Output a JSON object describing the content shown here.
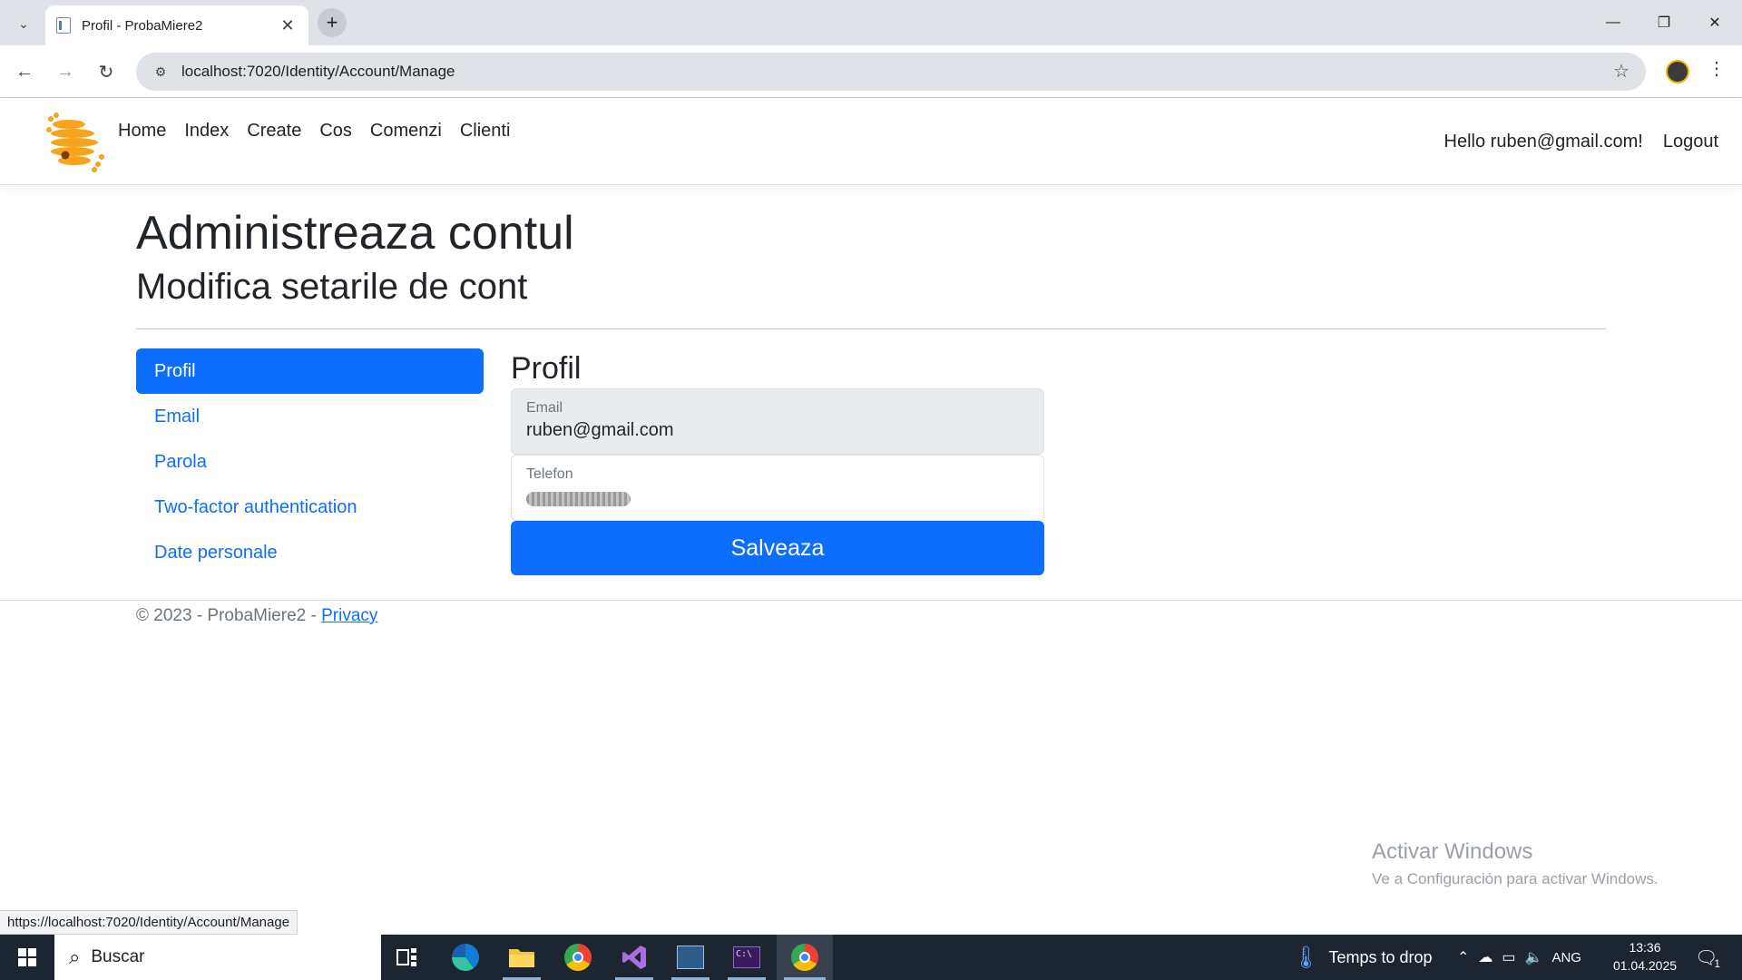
{
  "browser": {
    "tab_title": "Profil - ProbaMiere2",
    "url": "localhost:7020/Identity/Account/Manage",
    "status_url": "https://localhost:7020/Identity/Account/Manage"
  },
  "site": {
    "nav_links": [
      "Home",
      "Index",
      "Create",
      "Cos",
      "Comenzi",
      "Clienti"
    ],
    "greeting": "Hello ruben@gmail.com!",
    "logout": "Logout"
  },
  "page": {
    "title": "Administreaza contul",
    "subtitle": "Modifica setarile de cont"
  },
  "sidebar": {
    "items": [
      "Profil",
      "Email",
      "Parola",
      "Two-factor authentication",
      "Date personale"
    ]
  },
  "profile_form": {
    "heading": "Profil",
    "email_label": "Email",
    "email_value": "ruben@gmail.com",
    "phone_label": "Telefon",
    "save_label": "Salveaza"
  },
  "footer": {
    "text": "© 2023 - ProbaMiere2 - ",
    "privacy": "Privacy"
  },
  "watermark": {
    "line1": "Activar Windows",
    "line2": "Ve a Configuración para activar Windows."
  },
  "taskbar": {
    "search_placeholder": "Buscar",
    "weather": "Temps to drop",
    "language": "ANG",
    "time": "13:36",
    "date": "01.04.2025",
    "notification_count": "1"
  },
  "colors": {
    "primary": "#0d6efd",
    "taskbar": "#1c2530",
    "tab_strip": "#dfe3e7"
  }
}
